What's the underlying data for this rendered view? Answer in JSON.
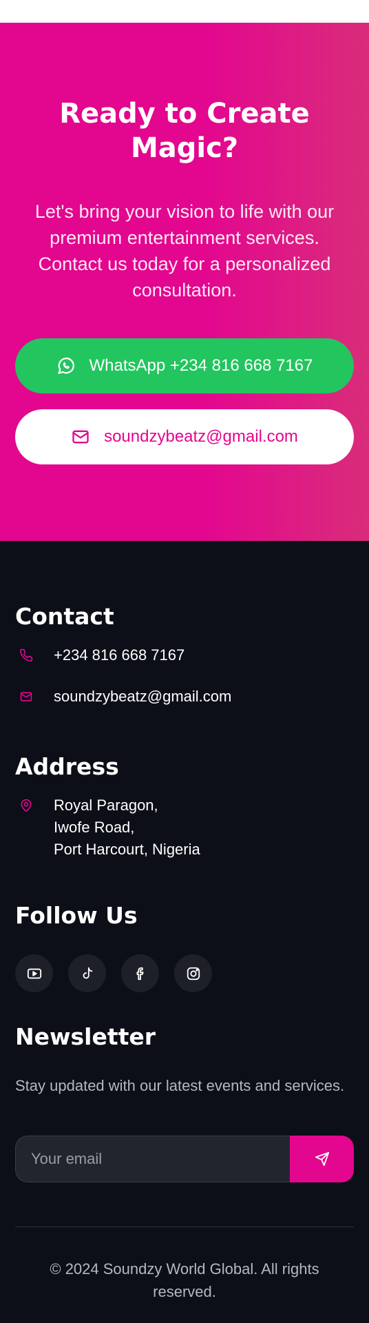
{
  "cta": {
    "title": "Ready to Create Magic?",
    "text": "Let's bring your vision to life with our premium entertainment services. Contact us today for a personalized consultation.",
    "whatsapp_label": "WhatsApp +234 816 668 7167",
    "email_label": "soundzybeatz@gmail.com"
  },
  "contact": {
    "title": "Contact",
    "phone": "+234 816 668 7167",
    "email": "soundzybeatz@gmail.com"
  },
  "address": {
    "title": "Address",
    "lines": [
      "Royal Paragon,",
      "Iwofe Road,",
      "Port Harcourt, Nigeria"
    ]
  },
  "follow": {
    "title": "Follow Us",
    "icons": [
      "youtube-icon",
      "tiktok-icon",
      "facebook-icon",
      "instagram-icon"
    ]
  },
  "newsletter": {
    "title": "Newsletter",
    "text": "Stay updated with our latest events and services.",
    "placeholder": "Your email"
  },
  "footer": {
    "copyright": "© 2024 Soundzy World Global. All rights reserved."
  },
  "colors": {
    "accent": "#e3068f",
    "whatsapp": "#22c55e",
    "footer_bg": "#0c0e18"
  }
}
